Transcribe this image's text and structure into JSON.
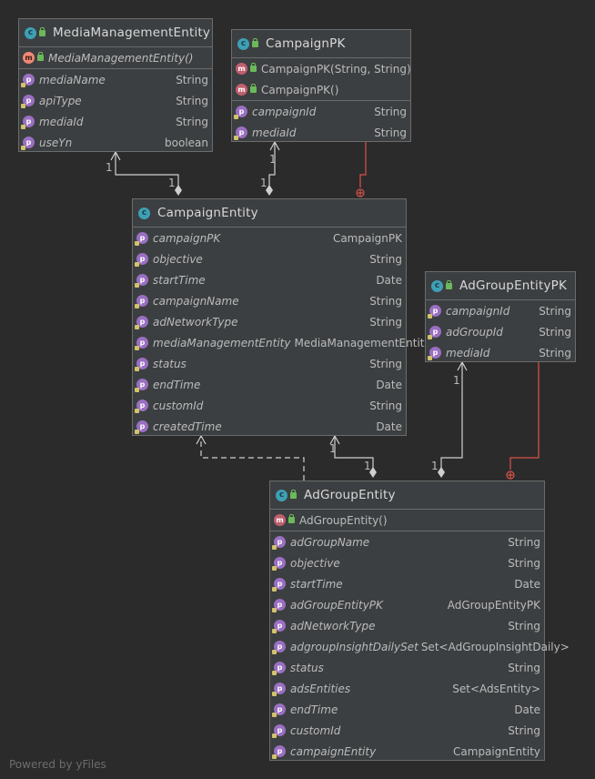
{
  "entities": {
    "media": {
      "title": "MediaManagementEntity",
      "methods": [
        {
          "name": "MediaManagementEntity()"
        }
      ],
      "fields": [
        {
          "name": "mediaName",
          "type": "String"
        },
        {
          "name": "apiType",
          "type": "String"
        },
        {
          "name": "mediaId",
          "type": "String"
        },
        {
          "name": "useYn",
          "type": "boolean"
        }
      ]
    },
    "campaignpk": {
      "title": "CampaignPK",
      "methods": [
        {
          "name": "CampaignPK(String, String)"
        },
        {
          "name": "CampaignPK()"
        }
      ],
      "fields": [
        {
          "name": "campaignId",
          "type": "String"
        },
        {
          "name": "mediaId",
          "type": "String"
        }
      ]
    },
    "campaign": {
      "title": "CampaignEntity",
      "fields": [
        {
          "name": "campaignPK",
          "type": "CampaignPK"
        },
        {
          "name": "objective",
          "type": "String"
        },
        {
          "name": "startTime",
          "type": "Date"
        },
        {
          "name": "campaignName",
          "type": "String"
        },
        {
          "name": "adNetworkType",
          "type": "String"
        },
        {
          "name": "mediaManagementEntity",
          "type": "MediaManagementEntity"
        },
        {
          "name": "status",
          "type": "String"
        },
        {
          "name": "endTime",
          "type": "Date"
        },
        {
          "name": "customId",
          "type": "String"
        },
        {
          "name": "createdTime",
          "type": "Date"
        }
      ]
    },
    "adgrouppk": {
      "title": "AdGroupEntityPK",
      "fields": [
        {
          "name": "campaignId",
          "type": "String"
        },
        {
          "name": "adGroupId",
          "type": "String"
        },
        {
          "name": "mediaId",
          "type": "String"
        }
      ]
    },
    "adgroup": {
      "title": "AdGroupEntity",
      "methods": [
        {
          "name": "AdGroupEntity()"
        }
      ],
      "fields": [
        {
          "name": "adGroupName",
          "type": "String"
        },
        {
          "name": "objective",
          "type": "String"
        },
        {
          "name": "startTime",
          "type": "Date"
        },
        {
          "name": "adGroupEntityPK",
          "type": "AdGroupEntityPK"
        },
        {
          "name": "adNetworkType",
          "type": "String"
        },
        {
          "name": "adgroupInsightDailySet",
          "type": "Set<AdGroupInsightDaily>"
        },
        {
          "name": "status",
          "type": "String"
        },
        {
          "name": "adsEntities",
          "type": "Set<AdsEntity>"
        },
        {
          "name": "endTime",
          "type": "Date"
        },
        {
          "name": "customId",
          "type": "String"
        },
        {
          "name": "campaignEntity",
          "type": "CampaignEntity"
        }
      ]
    }
  },
  "icons": {
    "class": "c",
    "field": "p",
    "method": "m"
  },
  "multiplicity": "1",
  "footer": "Powered by yFiles"
}
